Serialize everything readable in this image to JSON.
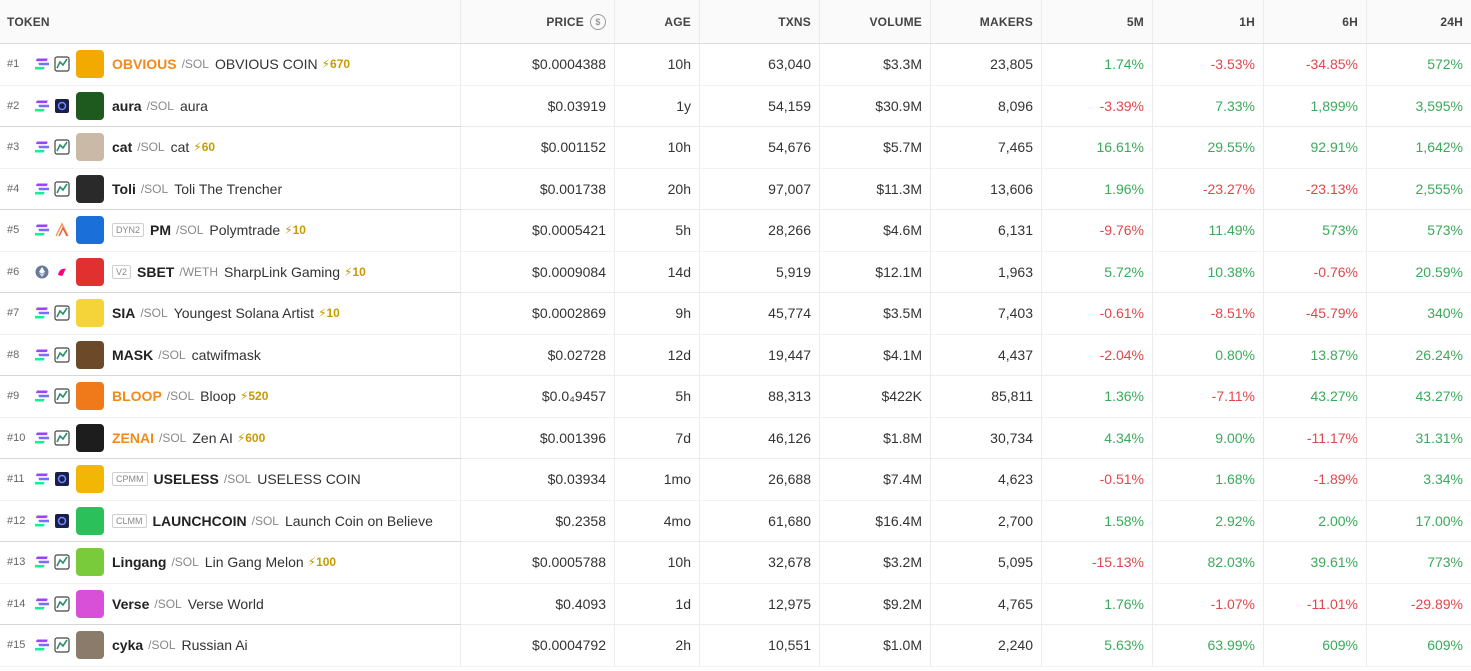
{
  "headers": {
    "token": "TOKEN",
    "price": "PRICE",
    "age": "AGE",
    "txns": "TXNS",
    "volume": "VOLUME",
    "makers": "MAKERS",
    "m5": "5M",
    "h1": "1H",
    "h6": "6H",
    "h24": "24H"
  },
  "colors": {
    "positive": "#3aaa5b",
    "negative": "#e0474c",
    "boost": "#c89b00",
    "highlight_symbol": "#f18a1c"
  },
  "rows": [
    {
      "rank": "#1",
      "chain": "solana-icon",
      "dex": "raydium-icon",
      "tag": "",
      "symbol": "OBVIOUS",
      "highlight": true,
      "quote": "/SOL",
      "name": "OBVIOUS COIN",
      "boost": "⚡670",
      "avatar_bg": "#f2a900",
      "price": "$0.0004388",
      "age": "10h",
      "txns": "63,040",
      "volume": "$3.3M",
      "makers": "23,805",
      "m5": "1.74%",
      "h1": "-3.53%",
      "h6": "-34.85%",
      "h24": "572%"
    },
    {
      "rank": "#2",
      "chain": "solana-icon",
      "dex": "meteora-icon",
      "tag": "",
      "symbol": "aura",
      "highlight": false,
      "quote": "/SOL",
      "name": "aura",
      "boost": "",
      "avatar_bg": "#1e5a1e",
      "price": "$0.03919",
      "age": "1y",
      "txns": "54,159",
      "volume": "$30.9M",
      "makers": "8,096",
      "m5": "-3.39%",
      "h1": "7.33%",
      "h6": "1,899%",
      "h24": "3,595%"
    },
    {
      "rank": "#3",
      "chain": "solana-icon",
      "dex": "raydium-icon",
      "tag": "",
      "symbol": "cat",
      "highlight": false,
      "quote": "/SOL",
      "name": "cat",
      "boost": "⚡60",
      "avatar_bg": "#c9b9a6",
      "price": "$0.001152",
      "age": "10h",
      "txns": "54,676",
      "volume": "$5.7M",
      "makers": "7,465",
      "m5": "16.61%",
      "h1": "29.55%",
      "h6": "92.91%",
      "h24": "1,642%"
    },
    {
      "rank": "#4",
      "chain": "solana-icon",
      "dex": "raydium-icon",
      "tag": "",
      "symbol": "Toli",
      "highlight": false,
      "quote": "/SOL",
      "name": "Toli The Trencher",
      "boost": "",
      "avatar_bg": "#2a2a2a",
      "price": "$0.001738",
      "age": "20h",
      "txns": "97,007",
      "volume": "$11.3M",
      "makers": "13,606",
      "m5": "1.96%",
      "h1": "-23.27%",
      "h6": "-23.13%",
      "h24": "2,555%"
    },
    {
      "rank": "#5",
      "chain": "solana-icon",
      "dex": "orca-icon",
      "tag": "DYN2",
      "symbol": "PM",
      "highlight": false,
      "quote": "/SOL",
      "name": "Polymtrade",
      "boost": "⚡10",
      "avatar_bg": "#1a6fd8",
      "price": "$0.0005421",
      "age": "5h",
      "txns": "28,266",
      "volume": "$4.6M",
      "makers": "6,131",
      "m5": "-9.76%",
      "h1": "11.49%",
      "h6": "573%",
      "h24": "573%"
    },
    {
      "rank": "#6",
      "chain": "ethereum-icon",
      "dex": "uniswap-icon",
      "tag": "V2",
      "symbol": "SBET",
      "highlight": false,
      "quote": "/WETH",
      "name": "SharpLink Gaming",
      "boost": "⚡10",
      "avatar_bg": "#e03030",
      "price": "$0.0009084",
      "age": "14d",
      "txns": "5,919",
      "volume": "$12.1M",
      "makers": "1,963",
      "m5": "5.72%",
      "h1": "10.38%",
      "h6": "-0.76%",
      "h24": "20.59%"
    },
    {
      "rank": "#7",
      "chain": "solana-icon",
      "dex": "raydium-icon",
      "tag": "",
      "symbol": "SIA",
      "highlight": false,
      "quote": "/SOL",
      "name": "Youngest Solana Artist",
      "boost": "⚡10",
      "avatar_bg": "#f5d43a",
      "price": "$0.0002869",
      "age": "9h",
      "txns": "45,774",
      "volume": "$3.5M",
      "makers": "7,403",
      "m5": "-0.61%",
      "h1": "-8.51%",
      "h6": "-45.79%",
      "h24": "340%"
    },
    {
      "rank": "#8",
      "chain": "solana-icon",
      "dex": "raydium-icon",
      "tag": "",
      "symbol": "MASK",
      "highlight": false,
      "quote": "/SOL",
      "name": "catwifmask",
      "boost": "",
      "avatar_bg": "#6b4a2a",
      "price": "$0.02728",
      "age": "12d",
      "txns": "19,447",
      "volume": "$4.1M",
      "makers": "4,437",
      "m5": "-2.04%",
      "h1": "0.80%",
      "h6": "13.87%",
      "h24": "26.24%"
    },
    {
      "rank": "#9",
      "chain": "solana-icon",
      "dex": "raydium-icon",
      "tag": "",
      "symbol": "BLOOP",
      "highlight": true,
      "quote": "/SOL",
      "name": "Bloop",
      "boost": "⚡520",
      "avatar_bg": "#f07a1a",
      "price": "$0.0₄9457",
      "age": "5h",
      "txns": "88,313",
      "volume": "$422K",
      "makers": "85,811",
      "m5": "1.36%",
      "h1": "-7.11%",
      "h6": "43.27%",
      "h24": "43.27%"
    },
    {
      "rank": "#10",
      "chain": "solana-icon",
      "dex": "raydium-icon",
      "tag": "",
      "symbol": "ZENAI",
      "highlight": true,
      "quote": "/SOL",
      "name": "Zen AI",
      "boost": "⚡600",
      "avatar_bg": "#1d1d1d",
      "price": "$0.001396",
      "age": "7d",
      "txns": "46,126",
      "volume": "$1.8M",
      "makers": "30,734",
      "m5": "4.34%",
      "h1": "9.00%",
      "h6": "-11.17%",
      "h24": "31.31%"
    },
    {
      "rank": "#11",
      "chain": "solana-icon",
      "dex": "meteora-icon",
      "tag": "CPMM",
      "symbol": "USELESS",
      "highlight": false,
      "quote": "/SOL",
      "name": "USELESS COIN",
      "boost": "",
      "avatar_bg": "#f2b705",
      "price": "$0.03934",
      "age": "1mo",
      "txns": "26,688",
      "volume": "$7.4M",
      "makers": "4,623",
      "m5": "-0.51%",
      "h1": "1.68%",
      "h6": "-1.89%",
      "h24": "3.34%"
    },
    {
      "rank": "#12",
      "chain": "solana-icon",
      "dex": "meteora-icon",
      "tag": "CLMM",
      "symbol": "LAUNCHCOIN",
      "highlight": false,
      "quote": "/SOL",
      "name": "Launch Coin on Believe",
      "boost": "",
      "avatar_bg": "#2bc05a",
      "price": "$0.2358",
      "age": "4mo",
      "txns": "61,680",
      "volume": "$16.4M",
      "makers": "2,700",
      "m5": "1.58%",
      "h1": "2.92%",
      "h6": "2.00%",
      "h24": "17.00%"
    },
    {
      "rank": "#13",
      "chain": "solana-icon",
      "dex": "raydium-icon",
      "tag": "",
      "symbol": "Lingang",
      "highlight": false,
      "quote": "/SOL",
      "name": "Lin Gang Melon",
      "boost": "⚡100",
      "avatar_bg": "#7acb3c",
      "price": "$0.0005788",
      "age": "10h",
      "txns": "32,678",
      "volume": "$3.2M",
      "makers": "5,095",
      "m5": "-15.13%",
      "h1": "82.03%",
      "h6": "39.61%",
      "h24": "773%"
    },
    {
      "rank": "#14",
      "chain": "solana-icon",
      "dex": "raydium-icon",
      "tag": "",
      "symbol": "Verse",
      "highlight": false,
      "quote": "/SOL",
      "name": "Verse World",
      "boost": "",
      "avatar_bg": "#d84fd8",
      "price": "$0.4093",
      "age": "1d",
      "txns": "12,975",
      "volume": "$9.2M",
      "makers": "4,765",
      "m5": "1.76%",
      "h1": "-1.07%",
      "h6": "-11.01%",
      "h24": "-29.89%"
    },
    {
      "rank": "#15",
      "chain": "solana-icon",
      "dex": "raydium-icon",
      "tag": "",
      "symbol": "cyka",
      "highlight": false,
      "quote": "/SOL",
      "name": "Russian Ai",
      "boost": "",
      "avatar_bg": "#8a7b6a",
      "price": "$0.0004792",
      "age": "2h",
      "txns": "10,551",
      "volume": "$1.0M",
      "makers": "2,240",
      "m5": "5.63%",
      "h1": "63.99%",
      "h6": "609%",
      "h24": "609%"
    }
  ]
}
